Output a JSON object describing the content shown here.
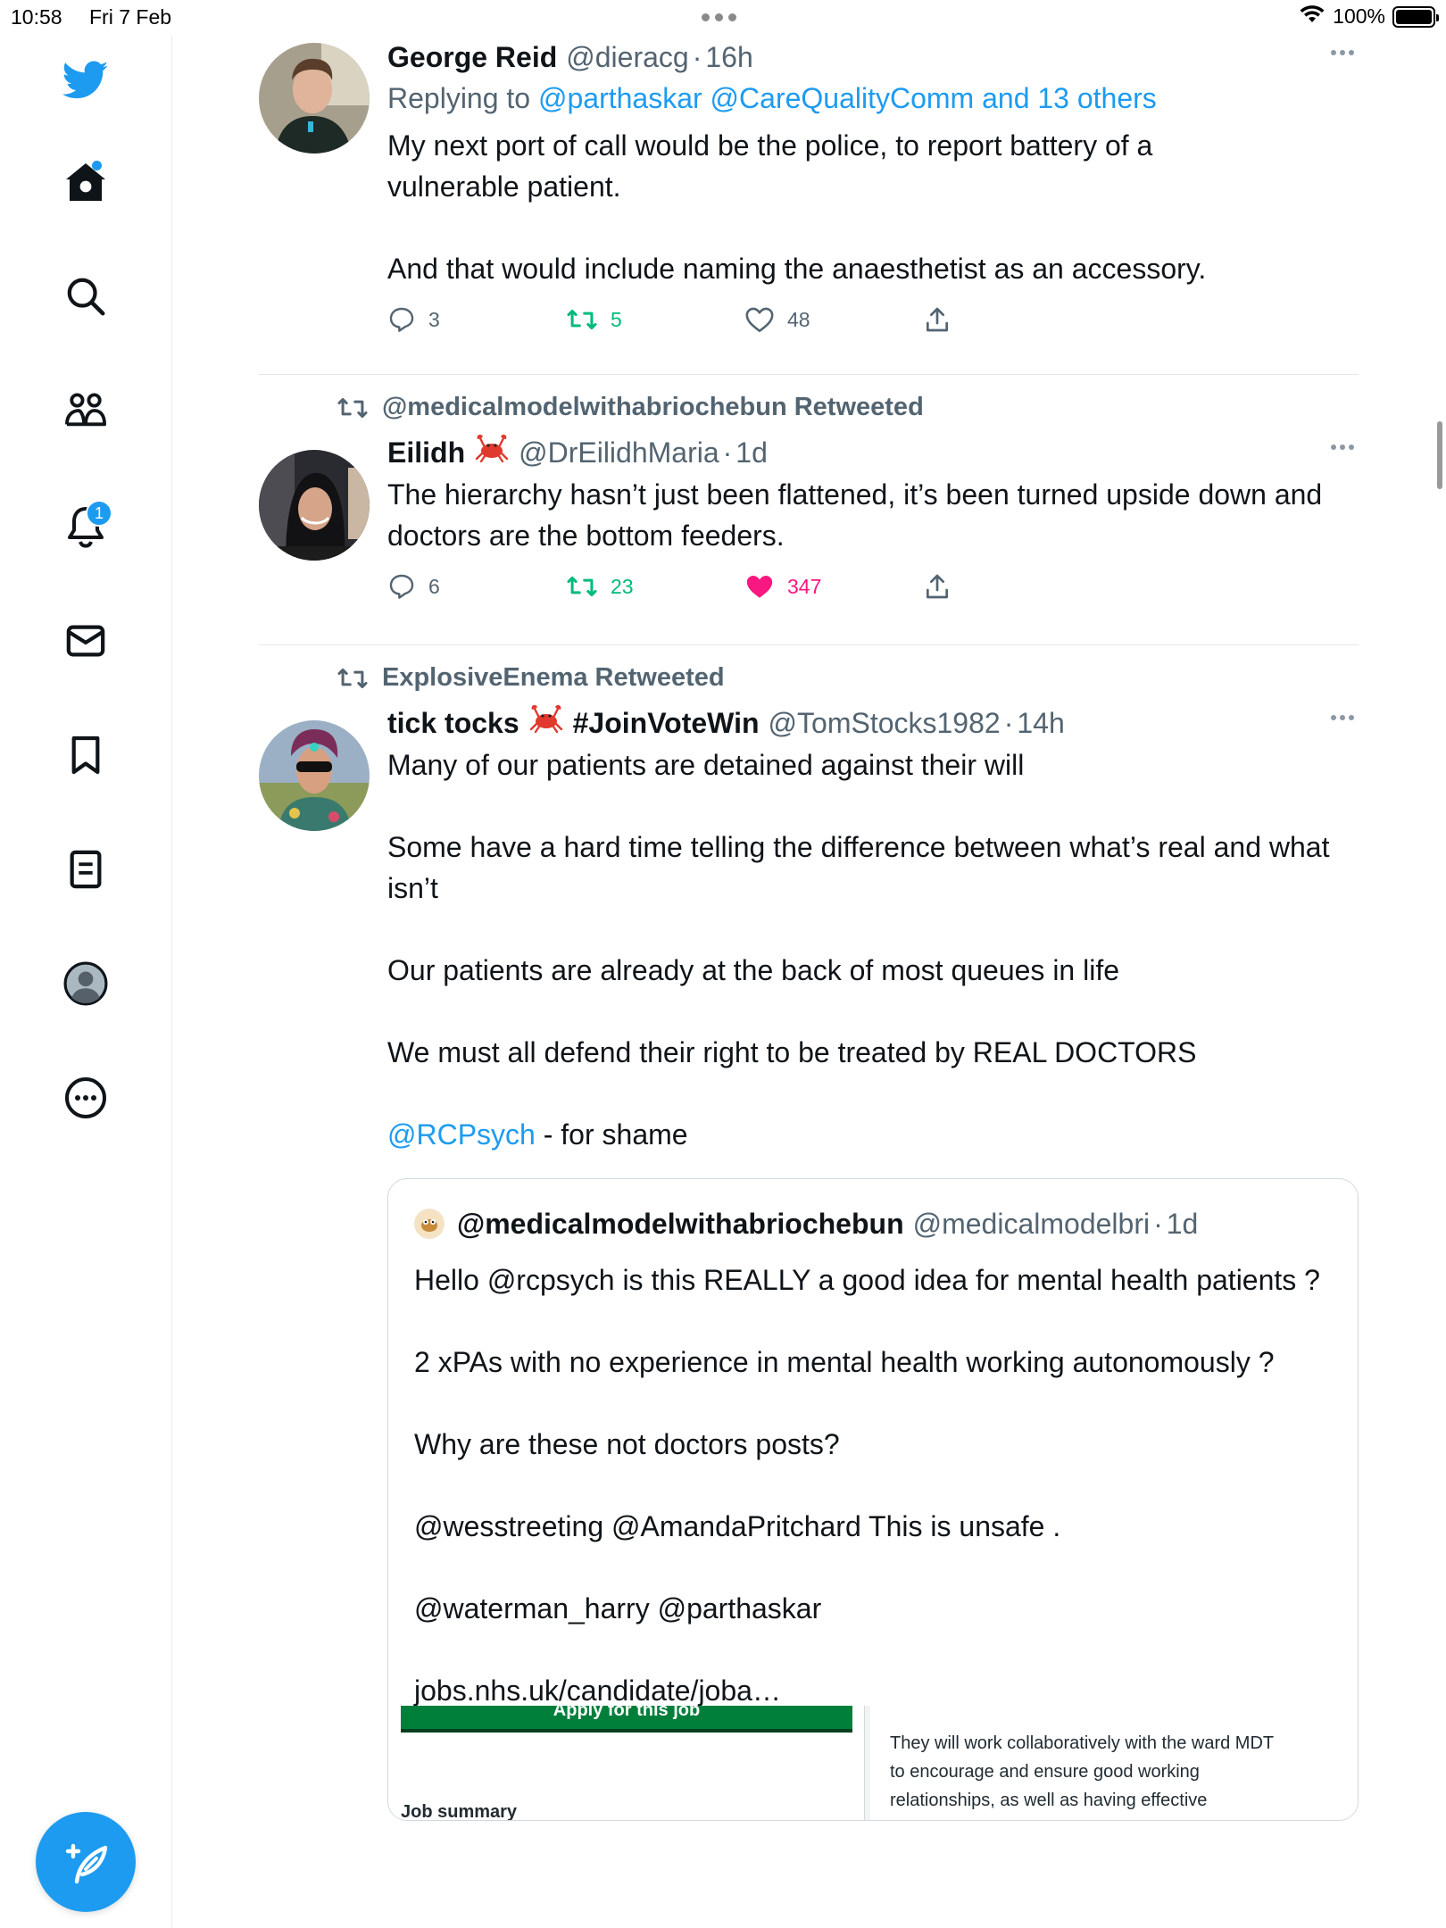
{
  "status_bar": {
    "time": "10:58",
    "date": "Fri 7 Feb",
    "battery": "100%"
  },
  "sidebar": {
    "icons": [
      "twitter-logo-icon",
      "home-icon",
      "search-icon",
      "communities-icon",
      "notifications-icon",
      "messages-icon",
      "bookmarks-icon",
      "lists-icon",
      "profile-icon",
      "more-icon"
    ],
    "notifications_badge": "1",
    "accent": "#1d9bf0"
  },
  "tweets": [
    {
      "name": "George Reid",
      "handle": "@dieracg",
      "time": "16h",
      "reply_prefix": "Replying to",
      "reply_to": "@parthaskar @CareQualityComm and 13 others",
      "text": [
        "My next port of call would be the police, to report battery of a vulnerable patient.",
        "",
        "And that would include naming the anaesthetist as an accessory."
      ],
      "replies": "3",
      "retweets": "5",
      "likes": "48"
    },
    {
      "retweeted_by": "@medicalmodelwithabriochebun Retweeted",
      "name": "Eilidh",
      "handle": "@DrEilidhMaria",
      "time": "1d",
      "text": [
        "The hierarchy hasn’t just been flattened, it’s been turned upside down and doctors are the bottom feeders."
      ],
      "replies": "6",
      "retweets": "23",
      "likes": "347",
      "like_color": "#f91880"
    },
    {
      "retweeted_by": "ExplosiveEnema Retweeted",
      "name": "tick tocks",
      "name_extra": "#JoinVoteWin",
      "handle": "@TomStocks1982",
      "time": "14h",
      "text": [
        "Many of our patients are detained against their will",
        "",
        "Some have a hard time telling the difference between what’s real and what isn’t",
        "",
        "Our patients are already at the back of most queues in life",
        "",
        "We must all defend their right to be treated by REAL DOCTORS",
        ""
      ],
      "mention": "@RCPsych",
      "mention_suffix": " - for shame",
      "quote": {
        "name": "@medicalmodelwithabriochebun",
        "handle": "@medicalmodelbri",
        "time": "1d",
        "text": [
          "Hello @rcpsych is this REALLY a good idea for mental health patients ?",
          "",
          "2 xPAs with no experience in mental health working autonomously ?",
          "",
          "Why are these not doctors posts?",
          "",
          "@wesstreeting @AmandaPritchard This is unsafe .",
          "",
          "@waterman_harry @parthaskar",
          "",
          "jobs.nhs.uk/candidate/joba…"
        ],
        "media": {
          "button": "Apply for this job",
          "summary_heading": "Job summary",
          "right_text": [
            "They will work collaboratively with the ward MDT",
            "to encourage and ensure good working",
            "relationships, as well as having effective"
          ]
        }
      }
    }
  ]
}
